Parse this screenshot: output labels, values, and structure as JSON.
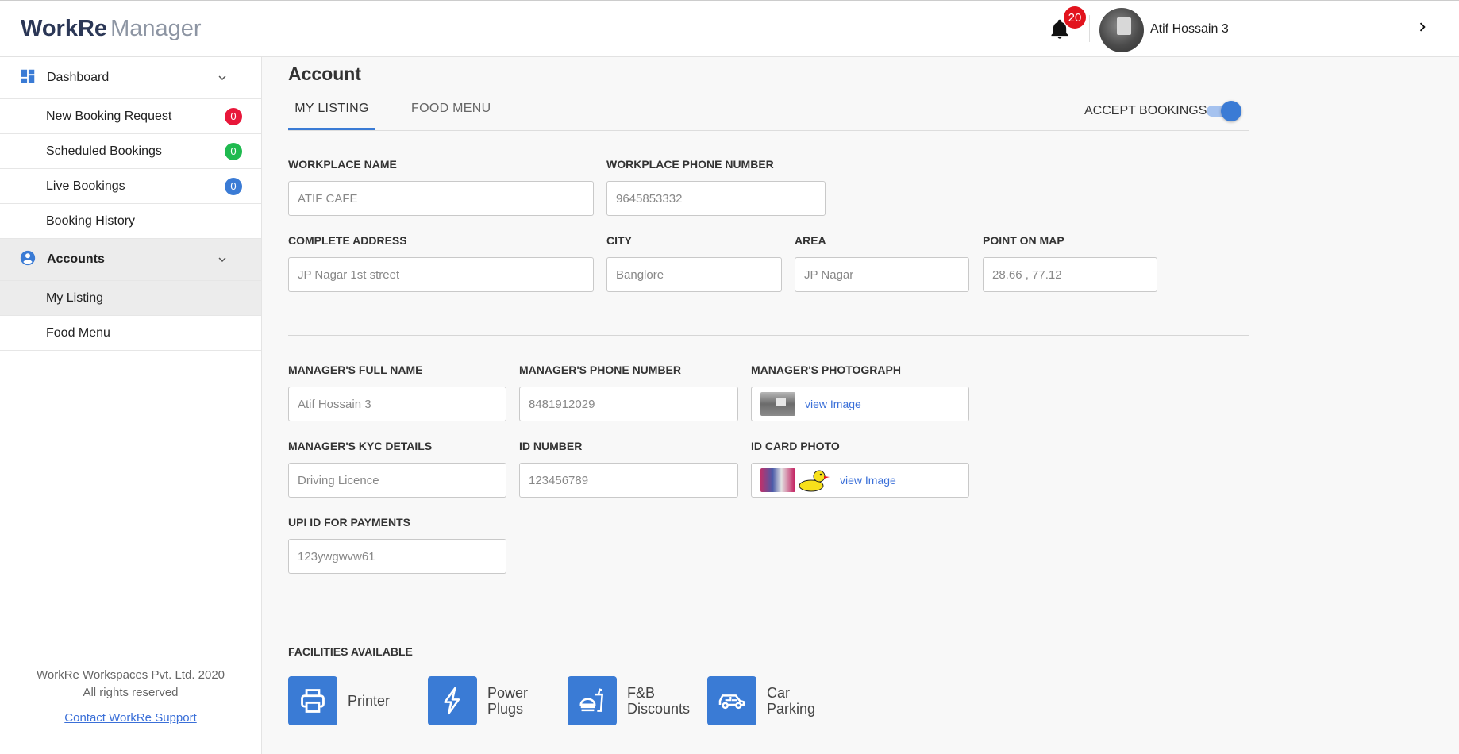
{
  "brand": {
    "name_bold": "WorkRe",
    "name_light": "Manager"
  },
  "header": {
    "notification_count": "20",
    "user_name": "Atif Hossain 3"
  },
  "sidebar": {
    "dashboard": {
      "label": "Dashboard",
      "items": [
        {
          "label": "New Booking Request",
          "count": "0",
          "color": "#e8173a"
        },
        {
          "label": "Scheduled Bookings",
          "count": "0",
          "color": "#1fba4f"
        },
        {
          "label": "Live Bookings",
          "count": "0",
          "color": "#3a7bd5"
        },
        {
          "label": "Booking History"
        }
      ]
    },
    "accounts": {
      "label": "Accounts",
      "items": [
        {
          "label": "My Listing",
          "active": true
        },
        {
          "label": "Food Menu"
        }
      ]
    },
    "footer": {
      "company": "WorkRe Workspaces Pvt. Ltd. 2020",
      "rights": "All rights reserved",
      "support_link": "Contact WorkRe Support"
    }
  },
  "main": {
    "title": "Account",
    "tabs": [
      {
        "label": "MY LISTING",
        "active": true
      },
      {
        "label": "FOOD MENU"
      }
    ],
    "accept_bookings": {
      "label": "ACCEPT BOOKINGS",
      "enabled": true
    },
    "workplace": {
      "name_label": "WORKPLACE NAME",
      "name_value": "ATIF CAFE",
      "phone_label": "WORKPLACE PHONE NUMBER",
      "phone_value": "9645853332",
      "address_label": "COMPLETE ADDRESS",
      "address_value": "JP Nagar 1st street",
      "city_label": "CITY",
      "city_value": "Banglore",
      "area_label": "AREA",
      "area_value": "JP Nagar",
      "map_label": "POINT ON MAP",
      "map_value": "28.66 , 77.12"
    },
    "manager": {
      "name_label": "MANAGER'S FULL NAME",
      "name_value": "Atif Hossain 3",
      "phone_label": "MANAGER'S PHONE NUMBER",
      "phone_value": "8481912029",
      "photo_label": "MANAGER'S PHOTOGRAPH",
      "photo_link": "view Image",
      "kyc_label": "MANAGER'S KYC DETAILS",
      "kyc_value": "Driving Licence",
      "id_label": "ID NUMBER",
      "id_value": "123456789",
      "id_photo_label": "ID CARD PHOTO",
      "id_photo_link": "view Image",
      "upi_label": "UPI ID FOR PAYMENTS",
      "upi_value": "123ywgwvw61"
    },
    "facilities": {
      "label": "FACILITIES AVAILABLE",
      "items": [
        {
          "label": "Printer",
          "icon": "printer-icon"
        },
        {
          "label": "Power Plugs",
          "icon": "power-plug-icon"
        },
        {
          "label": "F&B Discounts",
          "icon": "food-drink-icon"
        },
        {
          "label": "Car Parking",
          "icon": "car-icon"
        }
      ]
    }
  },
  "colors": {
    "accent": "#3a7bd5",
    "brand_dark": "#2b3756",
    "badge_red": "#e2131d"
  }
}
